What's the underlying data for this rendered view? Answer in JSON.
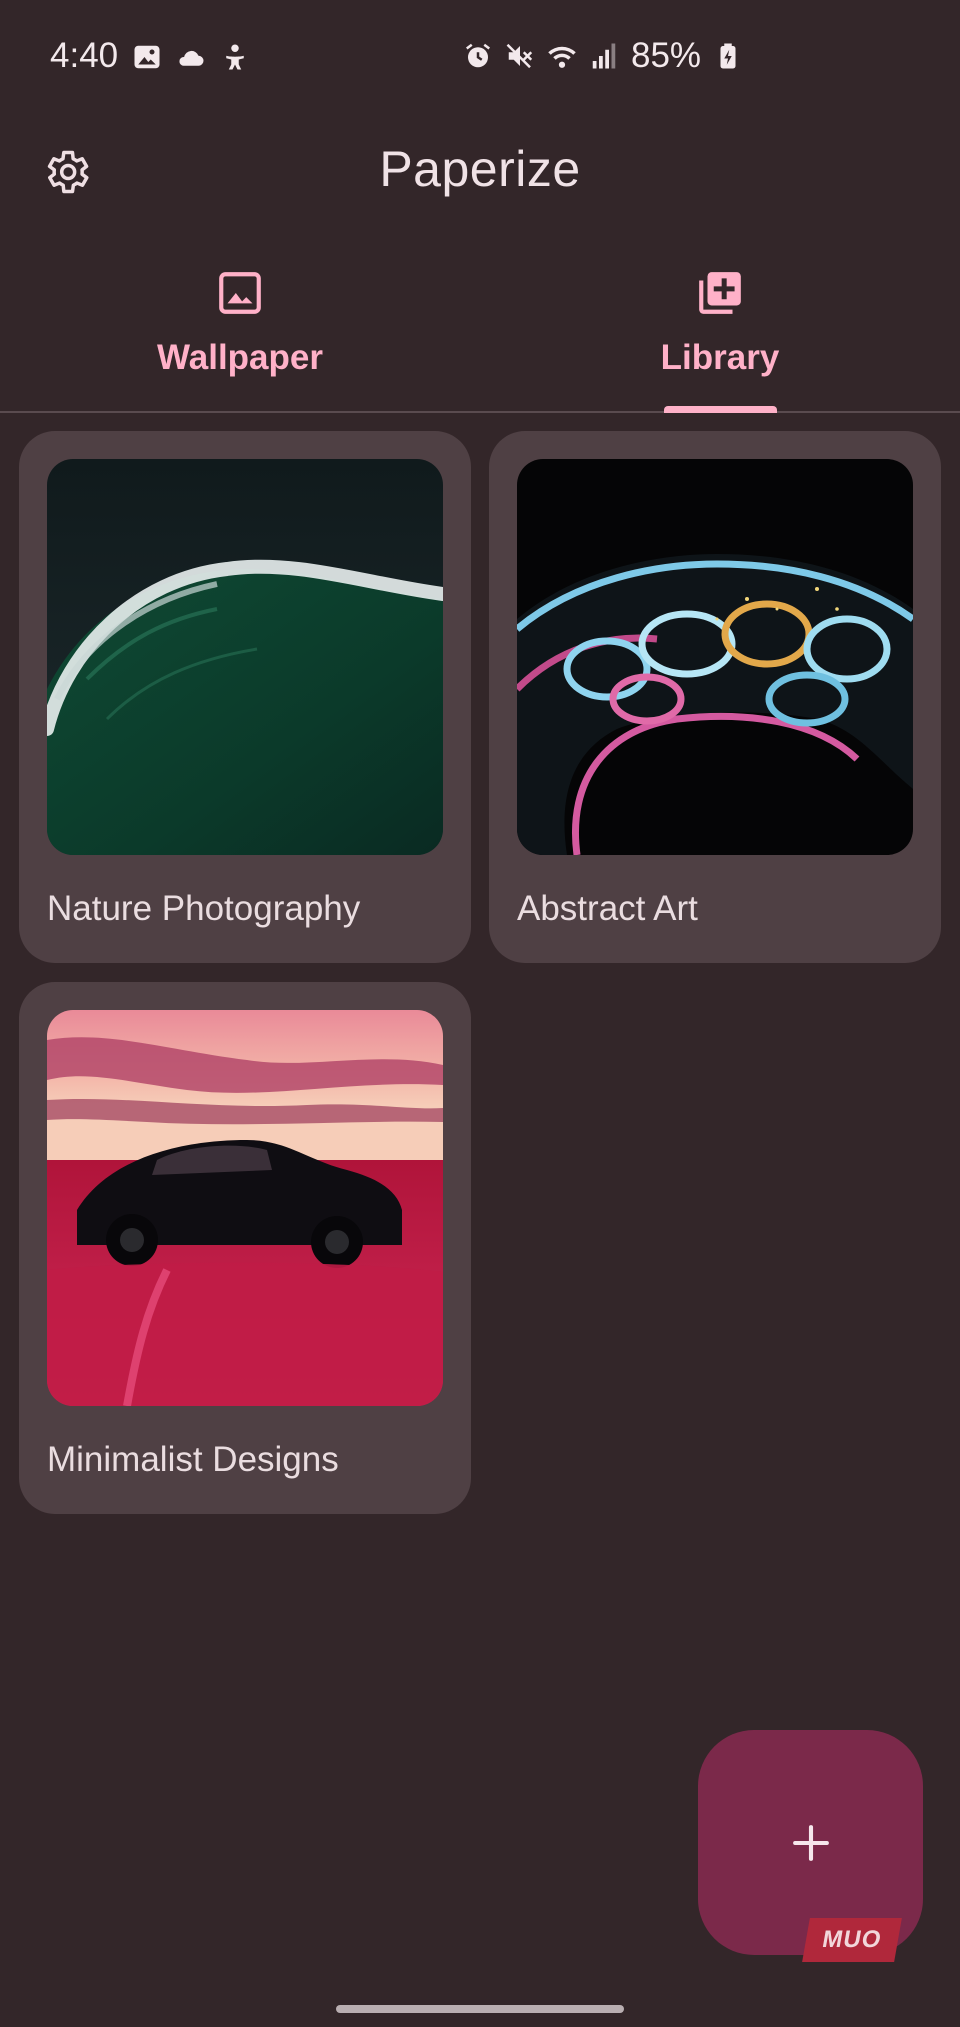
{
  "status_bar": {
    "time": "4:40",
    "battery": "85%",
    "left_icons": [
      "image-notification-icon",
      "cloud-icon",
      "accessibility-icon"
    ],
    "right_icons": [
      "alarm-icon",
      "mute-icon",
      "wifi-icon",
      "signal-icon",
      "battery-charging-icon"
    ]
  },
  "app_bar": {
    "title": "Paperize",
    "settings_icon": "gear-icon"
  },
  "tabs": [
    {
      "label": "Wallpaper",
      "icon": "image-icon",
      "selected": false
    },
    {
      "label": "Library",
      "icon": "library-add-icon",
      "selected": true
    }
  ],
  "library": {
    "albums": [
      {
        "name": "Nature Photography",
        "thumbnail": "green ocean wave"
      },
      {
        "name": "Abstract Art",
        "thumbnail": "iridescent bubble structure"
      },
      {
        "name": "Minimalist Designs",
        "thumbnail": "black sports car in pink field"
      }
    ]
  },
  "fab": {
    "icon": "plus-icon"
  },
  "watermark": "MUO",
  "colors": {
    "background": "#332629",
    "card": "#4f4044",
    "accent": "#ffb1c8",
    "fab": "#7b294a"
  }
}
